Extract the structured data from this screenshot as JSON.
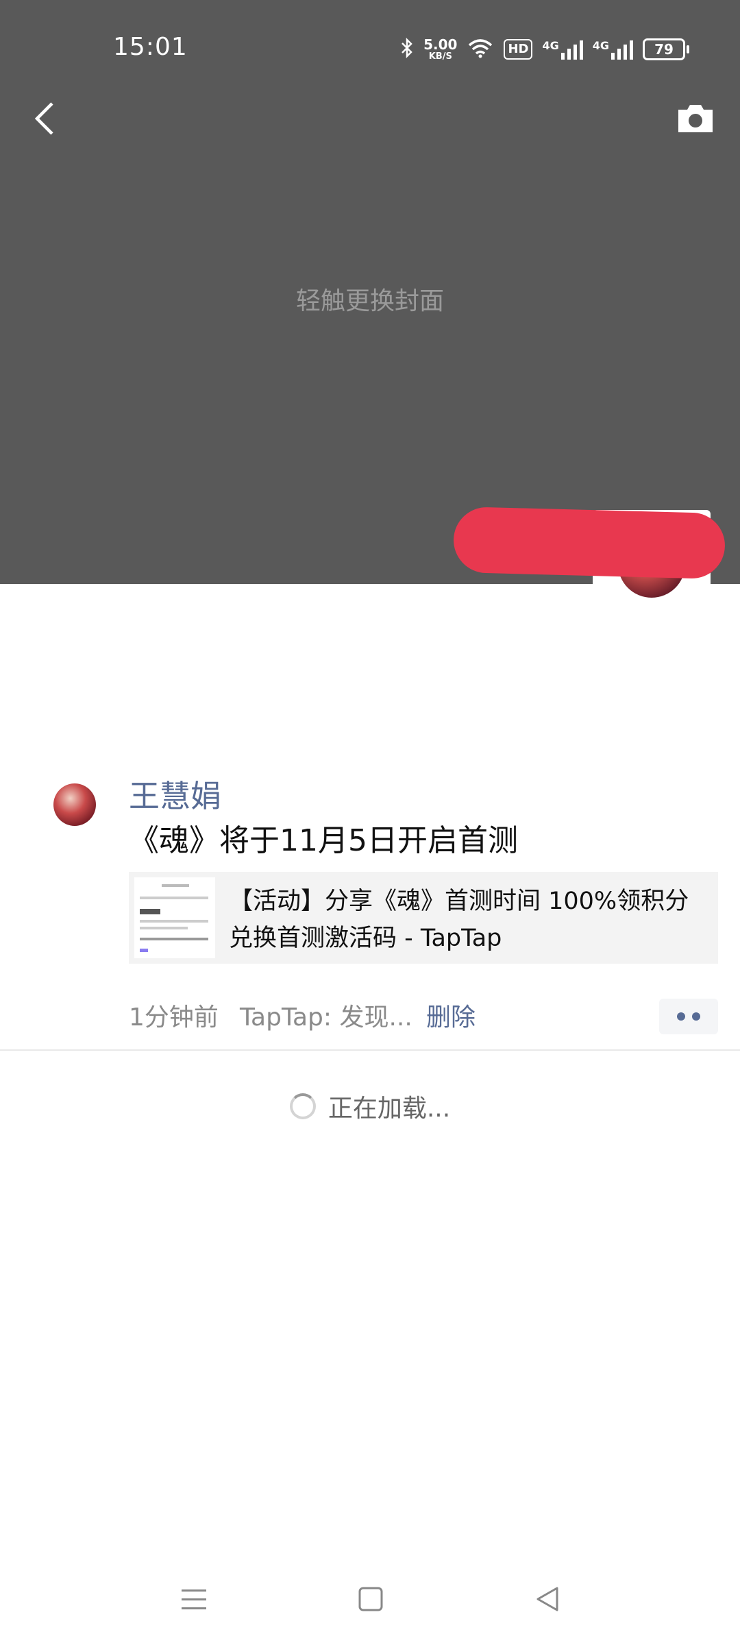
{
  "status_bar": {
    "time": "15:01",
    "net_speed_value": "5.00",
    "net_speed_unit": "KB/S",
    "hd_label": "HD",
    "signal1_label": "4G",
    "signal2_label": "4G",
    "battery": "79"
  },
  "cover": {
    "hint": "轻触更换封面"
  },
  "post": {
    "author": "王慧娟",
    "text": "《魂》将于11月5日开启首测",
    "link_title": "【活动】分享《魂》首测时间 100%领积分兑换首测激活码 - TapTap",
    "time_ago": "1分钟前",
    "source": "TapTap: 发现...",
    "delete_label": "删除"
  },
  "loading": {
    "text": "正在加载..."
  },
  "icons": {
    "back": "chevron-left-icon",
    "camera": "camera-icon",
    "menu": "menu-icon",
    "home": "square-icon",
    "back_nav": "triangle-left-icon"
  },
  "colors": {
    "cover_bg": "#595959",
    "link_blue": "#576b95",
    "redaction": "#e8384f"
  }
}
